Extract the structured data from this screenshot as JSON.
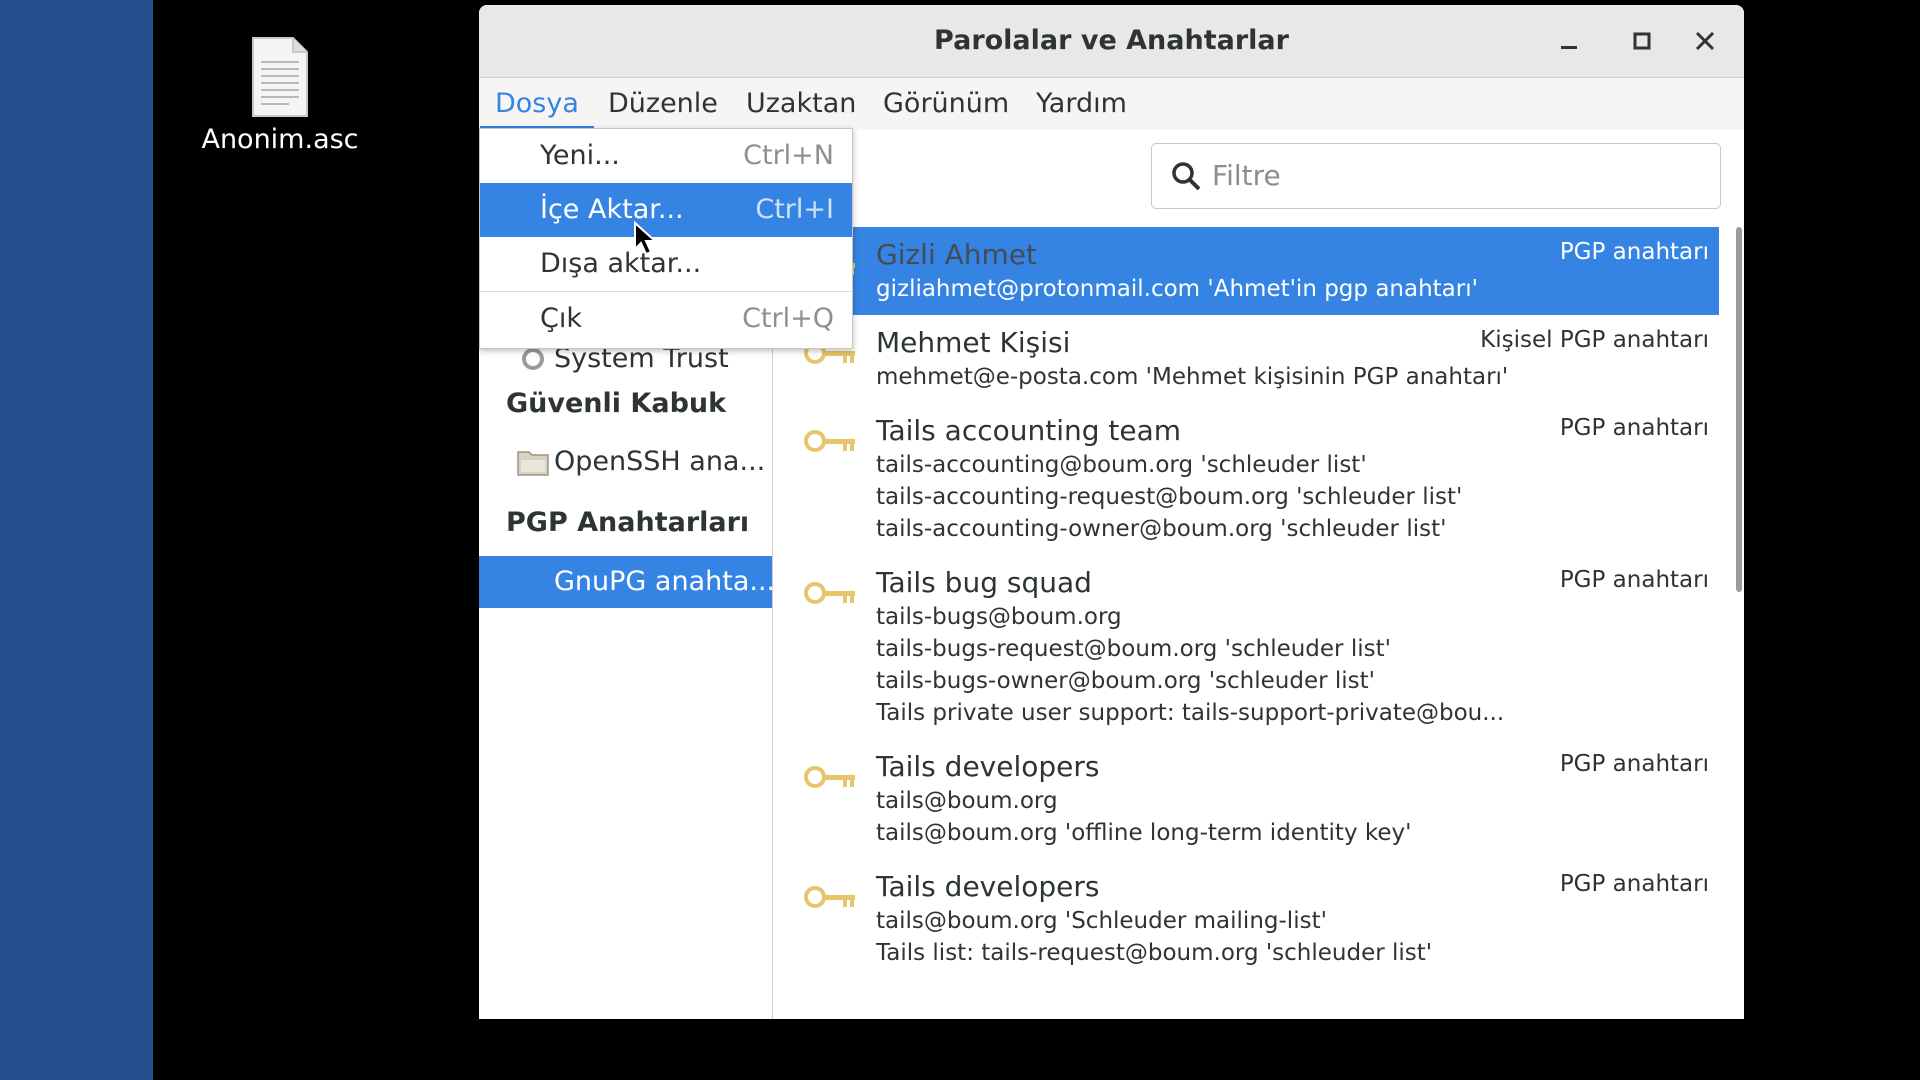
{
  "desktop": {
    "file_name": "Anonim.asc"
  },
  "window": {
    "title": "Parolalar ve Anahtarlar"
  },
  "menubar": {
    "items": [
      "Dosya",
      "Düzenle",
      "Uzaktan",
      "Görünüm",
      "Yardım"
    ],
    "active": "Dosya"
  },
  "file_menu": {
    "items": [
      {
        "label": "Yeni...",
        "shortcut": "Ctrl+N"
      },
      {
        "label": "İçe Aktar...",
        "shortcut": "Ctrl+I"
      },
      {
        "label": "Dışa aktar...",
        "shortcut": ""
      },
      {
        "label": "Çık",
        "shortcut": "Ctrl+Q"
      }
    ],
    "highlighted": "İçe Aktar..."
  },
  "sidebar": {
    "partial_item": "System Trust",
    "sections": [
      {
        "title": "Güvenli Kabuk",
        "items": [
          "OpenSSH ana..."
        ]
      },
      {
        "title": "PGP Anahtarları",
        "items": [
          "GnuPG anahta..."
        ]
      }
    ],
    "selected": "GnuPG anahta..."
  },
  "search": {
    "placeholder": "Filtre"
  },
  "keys": [
    {
      "name": "Gizli Ahmet",
      "type": "PGP anahtarı",
      "lines": [
        "gizliahmet@protonmail.com 'Ahmet'in pgp anahtarı'"
      ],
      "selected": true
    },
    {
      "name": "Mehmet Kişisi",
      "type": "Kişisel PGP anahtarı",
      "lines": [
        "mehmet@e-posta.com 'Mehmet kişisinin PGP anahtarı'"
      ]
    },
    {
      "name": "Tails accounting team",
      "type": "PGP anahtarı",
      "lines": [
        "tails-accounting@boum.org 'schleuder list'",
        "tails-accounting-request@boum.org 'schleuder list'",
        "tails-accounting-owner@boum.org 'schleuder list'"
      ]
    },
    {
      "name": "Tails bug squad",
      "type": "PGP anahtarı",
      "lines": [
        "tails-bugs@boum.org",
        "tails-bugs-request@boum.org 'schleuder list'",
        "tails-bugs-owner@boum.org 'schleuder list'",
        "Tails private user support: tails-support-private@bou..."
      ]
    },
    {
      "name": "Tails developers",
      "type": "PGP anahtarı",
      "lines": [
        "tails@boum.org",
        "tails@boum.org 'offline long-term identity key'"
      ]
    },
    {
      "name": "Tails developers",
      "type": "PGP anahtarı",
      "lines": [
        "tails@boum.org 'Schleuder mailing-list'",
        "Tails list: tails-request@boum.org 'schleuder list'"
      ]
    }
  ],
  "colors": {
    "accent": "#3584e4",
    "desktop_strip": "#264f8f"
  }
}
